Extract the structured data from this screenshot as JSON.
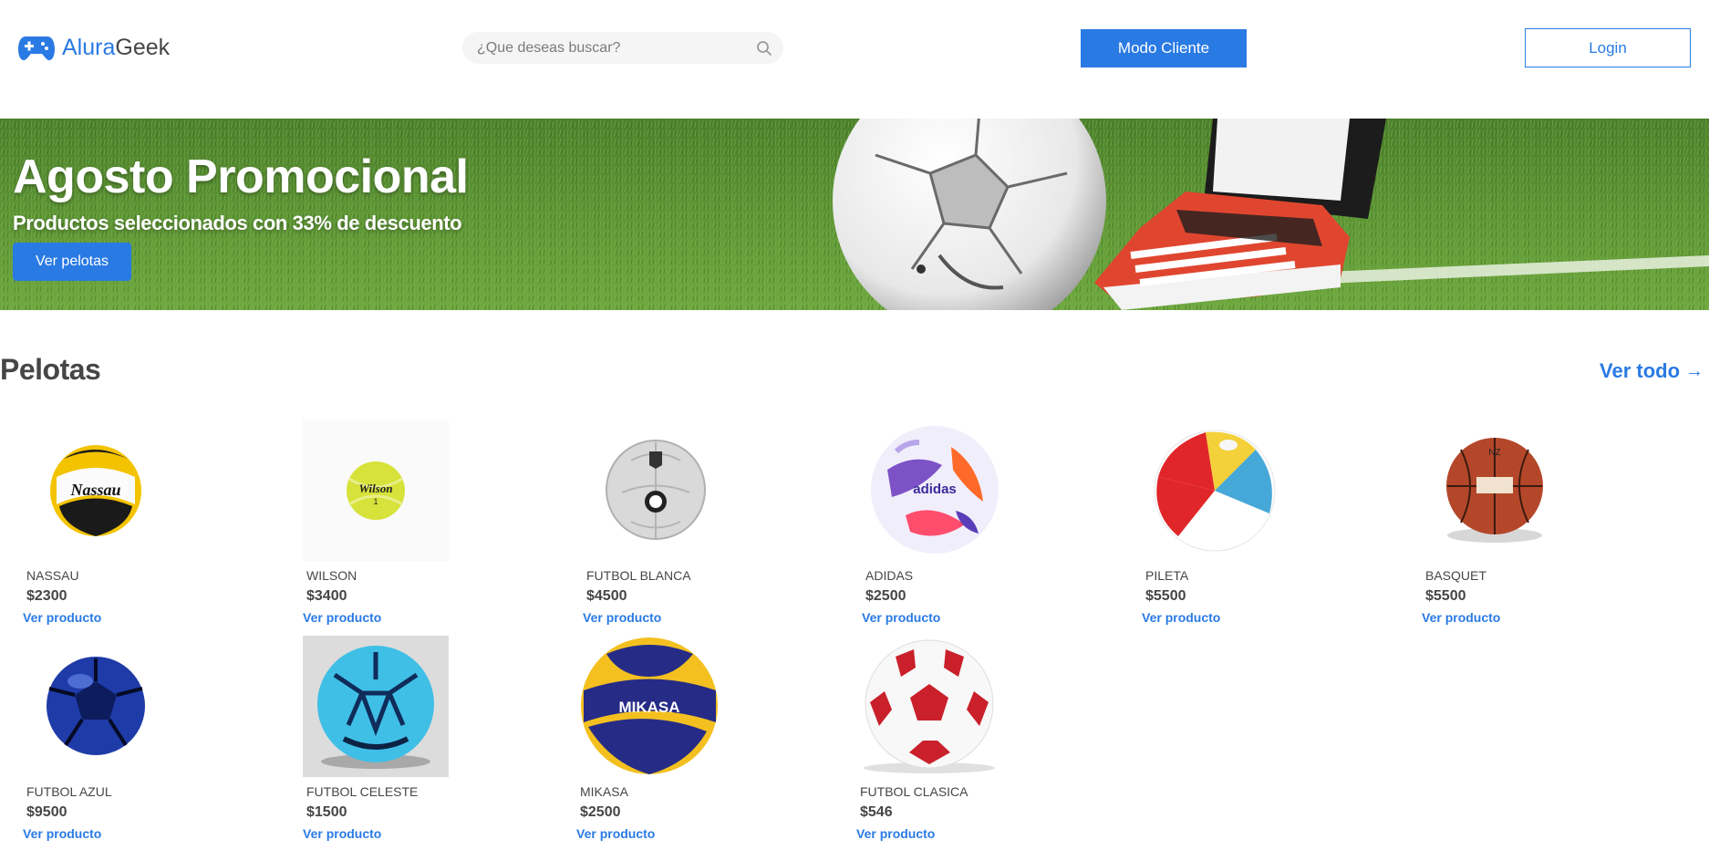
{
  "header": {
    "logo_part1": "Alura",
    "logo_part2": "Geek",
    "search_placeholder": "¿Que deseas buscar?",
    "mode_button": "Modo Cliente",
    "login_button": "Login"
  },
  "banner": {
    "title": "Agosto Promocional",
    "subtitle": "Productos seleccionados con 33% de descuento",
    "button": "Ver pelotas"
  },
  "section": {
    "title": "Pelotas",
    "see_all": "Ver todo",
    "arrow": "→"
  },
  "products": [
    {
      "name": "NASSAU",
      "price": "$2300",
      "link": "Ver producto",
      "ball_text": "Nassau"
    },
    {
      "name": "WILSON",
      "price": "$3400",
      "link": "Ver producto",
      "ball_text": "Wilson"
    },
    {
      "name": "FUTBOL BLANCA",
      "price": "$4500",
      "link": "Ver producto"
    },
    {
      "name": "ADIDAS",
      "price": "$2500",
      "link": "Ver producto",
      "ball_text": "adidas"
    },
    {
      "name": "PILETA",
      "price": "$5500",
      "link": "Ver producto"
    },
    {
      "name": "BASQUET",
      "price": "$5500",
      "link": "Ver producto"
    },
    {
      "name": "FUTBOL AZUL",
      "price": "$9500",
      "link": "Ver producto"
    },
    {
      "name": "FUTBOL CELESTE",
      "price": "$1500",
      "link": "Ver producto"
    },
    {
      "name": "MIKASA",
      "price": "$2500",
      "link": "Ver producto",
      "ball_text": "MIKASA"
    },
    {
      "name": "FUTBOL CLASICA",
      "price": "$546",
      "link": "Ver producto"
    }
  ],
  "colors": {
    "accent": "#2A7AE4",
    "text": "#464646",
    "search_bg": "#F5F5F5"
  }
}
